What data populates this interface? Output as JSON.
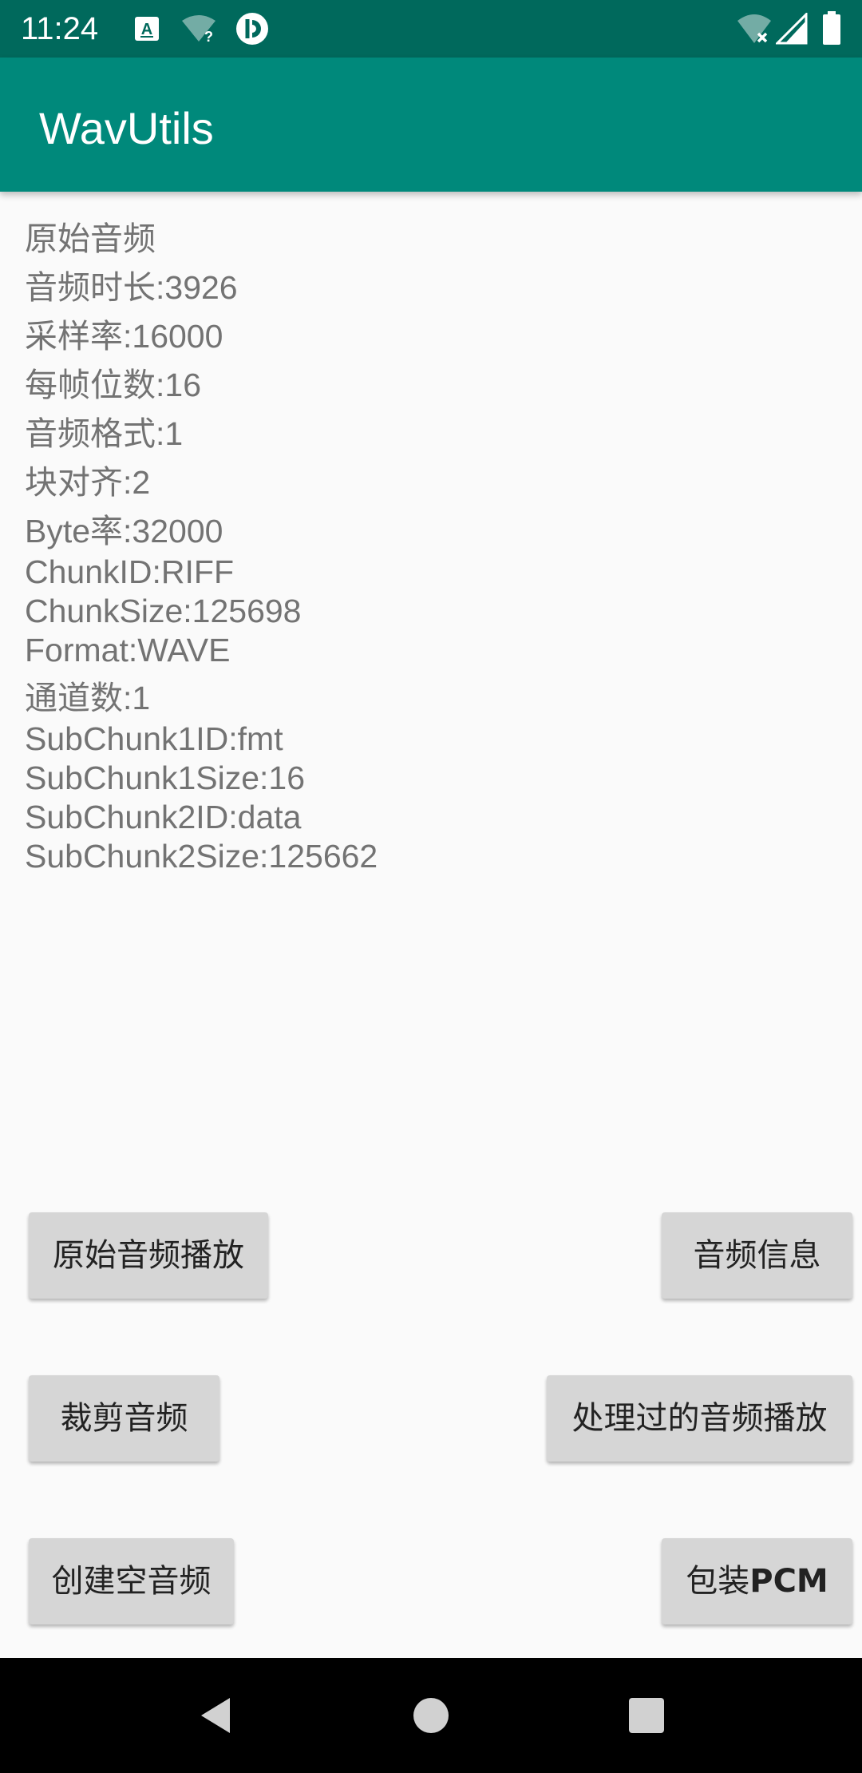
{
  "status_bar": {
    "time": "11:24",
    "icons": [
      "keyboard-a-icon",
      "wifi-question-icon",
      "circle-app-icon",
      "wifi-x-icon",
      "signal-icon",
      "battery-icon"
    ]
  },
  "app_bar": {
    "title": "WavUtils",
    "color": "#00897b",
    "status_color": "#00695c"
  },
  "info": {
    "header": "原始音频",
    "duration": "音频时长:3926",
    "sample_rate": "采样率:16000",
    "bits_per_sample": "每帧位数:16",
    "audio_format": "音频格式:1",
    "block_align": "块对齐:2",
    "byte_rate": "Byte率:32000",
    "chunk_id": "ChunkID:RIFF",
    "chunk_size": "ChunkSize:125698",
    "format": "Format:WAVE",
    "channels": "通道数:1",
    "subchunk1_id": "SubChunk1ID:fmt",
    "subchunk1_size": "SubChunk1Size:16",
    "subchunk2_id": "SubChunk2ID:data",
    "subchunk2_size": "SubChunk2Size:125662"
  },
  "buttons": {
    "play_original": "原始音频播放",
    "audio_info": "音频信息",
    "trim_audio": "裁剪音频",
    "play_processed": "处理过的音频播放",
    "create_empty": "创建空音频",
    "wrap_pcm_prefix": "包装",
    "wrap_pcm_suffix": "PCM"
  },
  "nav_bar": {
    "icons": [
      "back-icon",
      "home-icon",
      "recents-icon"
    ]
  }
}
